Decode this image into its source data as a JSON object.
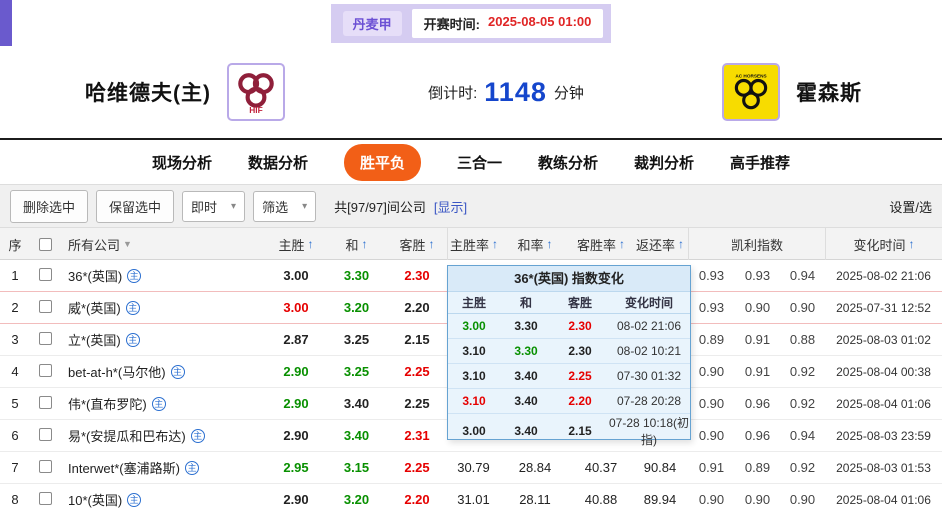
{
  "topbar": {
    "league": "丹麦甲",
    "start_label": "开赛时间:",
    "start_time": "2025-08-05 01:00"
  },
  "header": {
    "home_team": "哈维德夫(主)",
    "home_logo_text": "HIF",
    "countdown_label": "倒计时:",
    "countdown_value": "1148",
    "countdown_unit": "分钟",
    "away_team": "霍森斯",
    "away_logo_text": "AC HORSENS"
  },
  "tabs": [
    "现场分析",
    "数据分析",
    "胜平负",
    "三合一",
    "教练分析",
    "裁判分析",
    "高手推荐"
  ],
  "active_tab": "胜平负",
  "toolbar": {
    "delete_label": "删除选中",
    "keep_label": "保留选中",
    "instant_label": "即时",
    "filter_label": "筛选",
    "count_text": "共[97/97]间公司",
    "show_label": "[显示]",
    "settings_label": "设置/选"
  },
  "table": {
    "badge_label": "主",
    "headers": {
      "no": "序",
      "company": "所有公司",
      "home": "主胜",
      "draw": "和",
      "away": "客胜",
      "home_rate": "主胜率",
      "draw_rate": "和率",
      "away_rate": "客胜率",
      "payout": "返还率",
      "kelly": "凯利指数",
      "time": "变化时间"
    },
    "rows": [
      {
        "no": "1",
        "company": "36*(英国)",
        "home": "3.00",
        "home_c": "k",
        "draw": "3.30",
        "draw_c": "g",
        "away": "2.30",
        "away_c": "r",
        "k1": "0.93",
        "k2": "0.93",
        "k3": "0.94",
        "time": "2025-08-02 21:06"
      },
      {
        "no": "2",
        "company": "威*(英国)",
        "home": "3.00",
        "home_c": "r",
        "draw": "3.20",
        "draw_c": "g",
        "away": "2.20",
        "away_c": "k",
        "k1": "0.93",
        "k2": "0.90",
        "k3": "0.90",
        "time": "2025-07-31 12:52"
      },
      {
        "no": "3",
        "company": "立*(英国)",
        "home": "2.87",
        "home_c": "k",
        "draw": "3.25",
        "draw_c": "k",
        "away": "2.15",
        "away_c": "k",
        "k1": "0.89",
        "k2": "0.91",
        "k3": "0.88",
        "time": "2025-08-03 01:02"
      },
      {
        "no": "4",
        "company": "bet-at-h*(马尔他)",
        "home": "2.90",
        "home_c": "g",
        "draw": "3.25",
        "draw_c": "g",
        "away": "2.25",
        "away_c": "r",
        "k1": "0.90",
        "k2": "0.91",
        "k3": "0.92",
        "time": "2025-08-04 00:38"
      },
      {
        "no": "5",
        "company": "伟*(直布罗陀)",
        "home": "2.90",
        "home_c": "g",
        "draw": "3.40",
        "draw_c": "k",
        "away": "2.25",
        "away_c": "k",
        "k1": "0.90",
        "k2": "0.96",
        "k3": "0.92",
        "time": "2025-08-04 01:06"
      },
      {
        "no": "6",
        "company": "易*(安提瓜和巴布达)",
        "home": "2.90",
        "home_c": "k",
        "draw": "3.40",
        "draw_c": "g",
        "away": "2.31",
        "away_c": "r",
        "k1": "0.90",
        "k2": "0.96",
        "k3": "0.94",
        "time": "2025-08-03 23:59"
      },
      {
        "no": "7",
        "company": "Interwet*(塞浦路斯)",
        "home": "2.95",
        "home_c": "g",
        "draw": "3.15",
        "draw_c": "g",
        "away": "2.25",
        "away_c": "r",
        "rh": "30.79",
        "rd": "28.84",
        "ra": "40.37",
        "rr": "90.84",
        "k1": "0.91",
        "k2": "0.89",
        "k3": "0.92",
        "time": "2025-08-03 01:53"
      },
      {
        "no": "8",
        "company": "10*(英国)",
        "home": "2.90",
        "home_c": "k",
        "draw": "3.20",
        "draw_c": "g",
        "away": "2.20",
        "away_c": "r",
        "rh": "31.01",
        "rd": "28.11",
        "ra": "40.88",
        "rr": "89.94",
        "k1": "0.90",
        "k2": "0.90",
        "k3": "0.90",
        "time": "2025-08-04 01:06"
      }
    ]
  },
  "popup": {
    "title": "36*(英国) 指数变化",
    "headers": {
      "home": "主胜",
      "draw": "和",
      "away": "客胜",
      "time": "变化时间"
    },
    "rows": [
      {
        "home": "3.00",
        "home_c": "g",
        "draw": "3.30",
        "draw_c": "k",
        "away": "2.30",
        "away_c": "r",
        "time": "08-02 21:06"
      },
      {
        "home": "3.10",
        "home_c": "k",
        "draw": "3.30",
        "draw_c": "g",
        "away": "2.30",
        "away_c": "k",
        "time": "08-02 10:21"
      },
      {
        "home": "3.10",
        "home_c": "k",
        "draw": "3.40",
        "draw_c": "k",
        "away": "2.25",
        "away_c": "r",
        "time": "07-30 01:32"
      },
      {
        "home": "3.10",
        "home_c": "r",
        "draw": "3.40",
        "draw_c": "k",
        "away": "2.20",
        "away_c": "r",
        "time": "07-28 20:28"
      },
      {
        "home": "3.00",
        "home_c": "k",
        "draw": "3.40",
        "draw_c": "k",
        "away": "2.15",
        "away_c": "k",
        "time": "07-28 10:18(初指)"
      }
    ]
  },
  "colors": {
    "accent_purple": "#6a5acd",
    "lavender_strip": "#d5ccf1",
    "active_tab_orange": "#f25f17",
    "countdown_blue": "#1546cc",
    "odds_up_red": "#e60000",
    "odds_down_green": "#089000",
    "popup_bg": "#e9f4fc",
    "popup_border": "#66a3d2"
  }
}
